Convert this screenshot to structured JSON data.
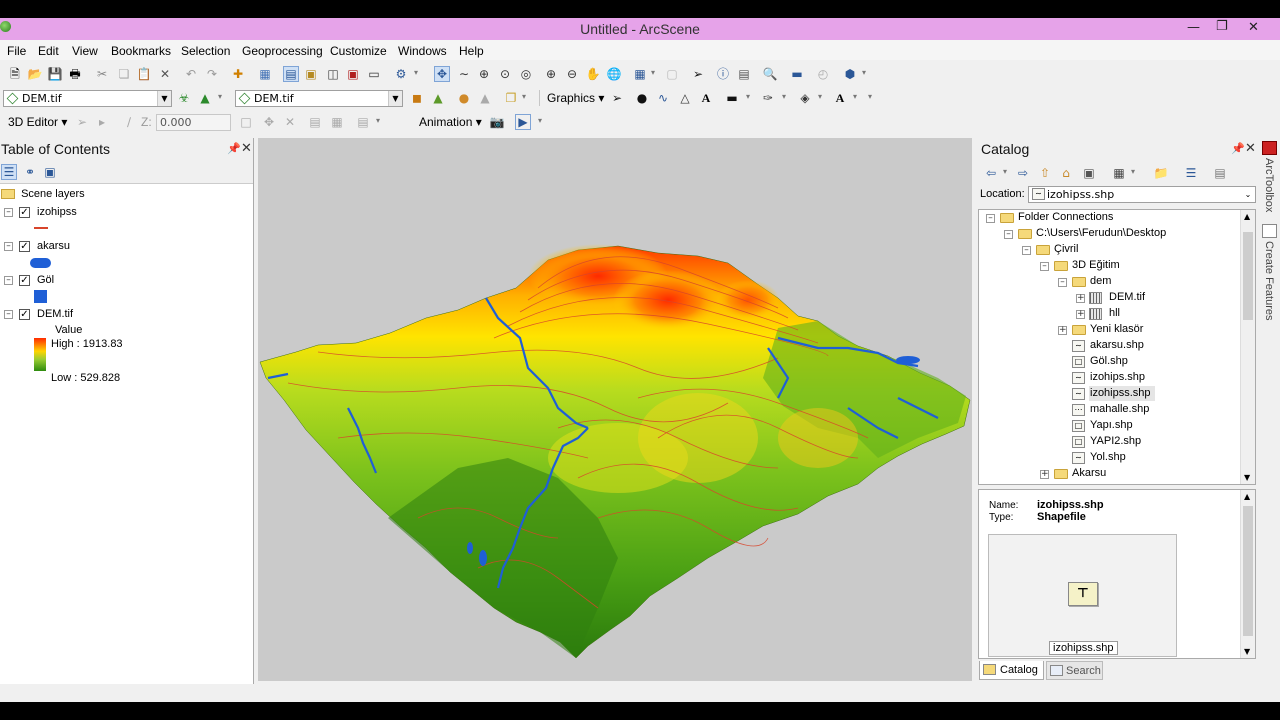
{
  "window": {
    "title": "Untitled - ArcScene"
  },
  "menu": [
    "File",
    "Edit",
    "View",
    "Bookmarks",
    "Selection",
    "Geoprocessing",
    "Customize",
    "Windows",
    "Help"
  ],
  "toolbar2": {
    "layer_combo_1": "DEM.tif",
    "layer_combo_2": "DEM.tif",
    "graphics_label": "Graphics"
  },
  "toolbar3": {
    "editor_label": "3D Editor",
    "z_label": "Z:",
    "z_value": "0.000",
    "animation_label": "Animation"
  },
  "toc": {
    "title": "Table of Contents",
    "root": "Scene layers",
    "layers": [
      {
        "name": "izohipss"
      },
      {
        "name": "akarsu"
      },
      {
        "name": "Göl"
      },
      {
        "name": "DEM.tif"
      }
    ],
    "legend": {
      "value_label": "Value",
      "high": "High : 1913.83",
      "low": "Low : 529.828"
    }
  },
  "catalog": {
    "title": "Catalog",
    "location_label": "Location:",
    "location_value": "izohipss.shp",
    "tree": [
      {
        "label": "Folder Connections",
        "icon": "folder-connections-icon"
      },
      {
        "label": "C:\\Users\\Ferudun\\Desktop",
        "icon": "folder-icon"
      },
      {
        "label": "Çivril",
        "icon": "folder-icon"
      },
      {
        "label": "3D Eğitim",
        "icon": "folder-icon"
      },
      {
        "label": "dem",
        "icon": "folder-icon"
      },
      {
        "label": "DEM.tif",
        "icon": "raster-icon"
      },
      {
        "label": "hll",
        "icon": "raster-icon"
      },
      {
        "label": "Yeni klasör",
        "icon": "folder-icon"
      },
      {
        "label": "akarsu.shp",
        "icon": "line-shapefile-icon"
      },
      {
        "label": "Göl.shp",
        "icon": "polygon-shapefile-icon"
      },
      {
        "label": "izohips.shp",
        "icon": "line-shapefile-icon"
      },
      {
        "label": "izohipss.shp",
        "icon": "line-shapefile-icon"
      },
      {
        "label": "mahalle.shp",
        "icon": "point-shapefile-icon"
      },
      {
        "label": "Yapı.shp",
        "icon": "polygon-shapefile-icon"
      },
      {
        "label": "YAPI2.shp",
        "icon": "polygon-shapefile-icon"
      },
      {
        "label": "Yol.shp",
        "icon": "line-shapefile-icon"
      },
      {
        "label": "Akarsu",
        "icon": "folder-icon"
      }
    ],
    "info": {
      "name_label": "Name:",
      "name_value": "izohipss.shp",
      "type_label": "Type:",
      "type_value": "Shapefile",
      "thumb_caption": "izohipss.shp"
    },
    "tabs": [
      "Catalog",
      "Search"
    ]
  },
  "side_tabs": [
    "ArcToolbox",
    "Create Features"
  ],
  "colors": {
    "title_bar": "#e6a3e9",
    "scene_bg": "#cacaca",
    "terrain_high": "#ff2a00",
    "terrain_low": "#2e8b0e",
    "river": "#1f5fd6",
    "contour": "#d8452b"
  }
}
